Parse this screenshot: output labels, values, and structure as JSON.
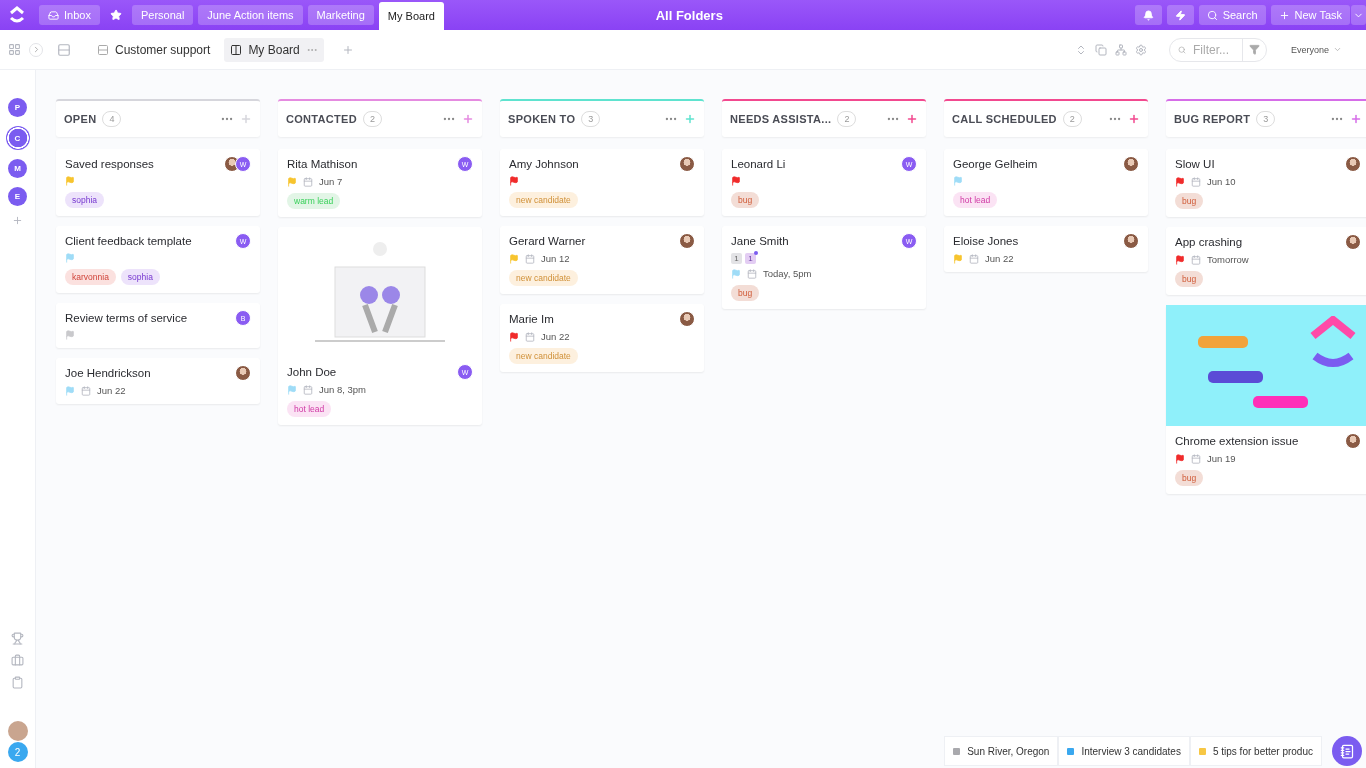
{
  "top_bar": {
    "tabs": [
      {
        "label": "Inbox",
        "kind": "inbox",
        "selected": false
      },
      {
        "label": "Personal",
        "kind": "plain",
        "selected": false
      },
      {
        "label": "June Action items",
        "kind": "plain",
        "selected": false
      },
      {
        "label": "Marketing",
        "kind": "plain",
        "selected": false
      },
      {
        "label": "My Board",
        "kind": "plain",
        "selected": true
      }
    ],
    "title": "All Folders",
    "search": "Search",
    "new_task": "New Task"
  },
  "sidebar": {
    "spaces": [
      {
        "initial": "P",
        "selected": false
      },
      {
        "initial": "C",
        "selected": true
      },
      {
        "initial": "M",
        "selected": false
      },
      {
        "initial": "E",
        "selected": false
      }
    ],
    "notification_count": "2"
  },
  "toolbar": {
    "views": [
      {
        "label": "Customer support",
        "kind": "list",
        "selected": false
      },
      {
        "label": "My Board",
        "kind": "board",
        "selected": true
      }
    ],
    "filter": {
      "placeholder": "Filter..."
    },
    "assignee_filter": "Everyone"
  },
  "columns": [
    {
      "name": "OPEN",
      "count": "4",
      "color": "#d6d6dc",
      "tasks": [
        {
          "title": "Saved responses",
          "kind": "plain",
          "color": "#f7c42e",
          "assignees": [
            {
              "kind": "photo"
            },
            {
              "kind": "initial",
              "initial": "W"
            }
          ],
          "tags": [
            {
              "label": "sophia",
              "color": "#ede3fb"
            }
          ]
        },
        {
          "title": "Client feedback template",
          "kind": "plain",
          "color": "#9fdcf7",
          "assignees": [
            {
              "kind": "initial",
              "initial": "W"
            }
          ],
          "tags": [
            {
              "label": "karvonnia",
              "color": "#fbe1df"
            },
            {
              "label": "sophia",
              "color": "#ede3fb"
            }
          ]
        },
        {
          "title": "Review terms of service",
          "kind": "plain",
          "color": "#c9c9cc",
          "assignees": [
            {
              "kind": "initial",
              "initial": "B"
            }
          ]
        },
        {
          "title": "Joe Hendrickson",
          "kind": "plain",
          "color": "#9fdcf7",
          "date": "Jun 22",
          "assignees": [
            {
              "kind": "photo"
            }
          ]
        }
      ]
    },
    {
      "name": "CONTACTED",
      "count": "2",
      "color": "#e58be0",
      "tasks": [
        {
          "title": "Rita Mathison",
          "kind": "plain",
          "color": "#f7c42e",
          "date": "Jun 7",
          "assignees": [
            {
              "kind": "initial",
              "initial": "W"
            }
          ],
          "tags": [
            {
              "label": "warm lead",
              "color": "#e2f5e6"
            }
          ]
        },
        {
          "title": "John Doe",
          "kind": "illustrated",
          "color": "#9fdcf7",
          "date": "Jun 8, 3pm",
          "assignees": [
            {
              "kind": "initial",
              "initial": "W"
            }
          ],
          "tags": [
            {
              "label": "hot lead",
              "color": "#fbe3f4"
            }
          ]
        }
      ]
    },
    {
      "name": "SPOKEN TO",
      "count": "3",
      "color": "#5fe3cf",
      "tasks": [
        {
          "title": "Amy Johnson",
          "kind": "plain",
          "color": "#f02b2b",
          "assignees": [
            {
              "kind": "photo"
            }
          ],
          "tags": [
            {
              "label": "new candidate",
              "color": "#fdf0de"
            }
          ]
        },
        {
          "title": "Gerard Warner",
          "kind": "plain",
          "color": "#f7c42e",
          "date": "Jun 12",
          "assignees": [
            {
              "kind": "photo"
            }
          ],
          "tags": [
            {
              "label": "new candidate",
              "color": "#fdf0de"
            }
          ]
        },
        {
          "title": "Marie Im",
          "kind": "plain",
          "color": "#f02b2b",
          "date": "Jun 22",
          "assignees": [
            {
              "kind": "photo"
            }
          ],
          "tags": [
            {
              "label": "new candidate",
              "color": "#fdf0de"
            }
          ]
        }
      ]
    },
    {
      "name": "NEEDS ASSISTA...",
      "count": "2",
      "color": "#f2498f",
      "tasks": [
        {
          "title": "Leonard Li",
          "kind": "plain",
          "color": "#f02b2b",
          "assignees": [
            {
              "kind": "initial",
              "initial": "W"
            }
          ],
          "tags": [
            {
              "label": "bug",
              "color": "#f3ddd6"
            }
          ]
        },
        {
          "title": "Jane Smith",
          "kind": "plain",
          "color": "#9fdcf7",
          "date": "Today, 5pm",
          "counters": [
            {
              "label": "1",
              "kind": "subtask"
            },
            {
              "label": "1",
              "kind": "attachment"
            }
          ],
          "assignees": [
            {
              "kind": "initial",
              "initial": "W"
            }
          ],
          "tags": [
            {
              "label": "bug",
              "color": "#f3ddd6"
            }
          ]
        }
      ]
    },
    {
      "name": "CALL SCHEDULED",
      "count": "2",
      "color": "#f2498f",
      "tasks": [
        {
          "title": "George Gelheim",
          "kind": "plain",
          "color": "#9fdcf7",
          "assignees": [
            {
              "kind": "photo"
            }
          ],
          "tags": [
            {
              "label": "hot lead",
              "color": "#fbe3f4"
            }
          ]
        },
        {
          "title": "Eloise Jones",
          "kind": "plain",
          "color": "#f7c42e",
          "date": "Jun 22",
          "assignees": [
            {
              "kind": "photo"
            }
          ]
        }
      ]
    },
    {
      "name": "BUG REPORT",
      "count": "3",
      "color": "#d66de8",
      "tasks": [
        {
          "title": "Slow UI",
          "kind": "plain",
          "color": "#f02b2b",
          "date": "Jun 10",
          "assignees": [
            {
              "kind": "photo"
            }
          ],
          "tags": [
            {
              "label": "bug",
              "color": "#f3ddd6"
            }
          ]
        },
        {
          "title": "App crashing",
          "kind": "plain",
          "color": "#f02b2b",
          "date": "Tomorrow",
          "assignees": [
            {
              "kind": "photo"
            }
          ],
          "tags": [
            {
              "label": "bug",
              "color": "#f3ddd6"
            }
          ]
        },
        {
          "title": "Chrome extension issue",
          "kind": "banner",
          "color": "#f02b2b",
          "date": "Jun 19",
          "assignees": [
            {
              "kind": "photo"
            }
          ],
          "tags": [
            {
              "label": "bug",
              "color": "#f3ddd6"
            }
          ]
        }
      ]
    }
  ],
  "tray": [
    {
      "label": "Sun River, Oregon",
      "color": "#a9a9ad"
    },
    {
      "label": "Interview 3 candidates",
      "color": "#3aa8ef"
    },
    {
      "label": "5 tips for better produc",
      "color": "#f7c744"
    }
  ]
}
